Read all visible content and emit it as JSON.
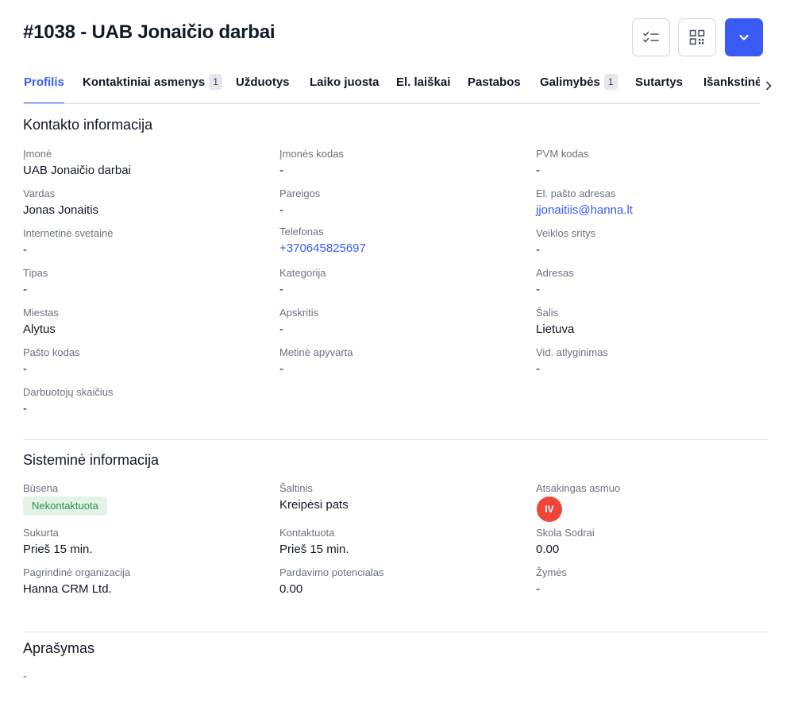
{
  "header": {
    "title": "#1038 - UAB Jonaičio darbai",
    "buttons": {
      "tasks_icon": "checklist-icon",
      "qr_icon": "qr-code-icon",
      "menu_icon": "chevron-down-icon",
      "primary_color": "#3b5bf6"
    }
  },
  "tabs": [
    {
      "label": "Profilis",
      "active": true
    },
    {
      "label": "Kontaktiniai asmenys",
      "badge": "1"
    },
    {
      "label": "Užduotys"
    },
    {
      "label": "Laiko juosta"
    },
    {
      "label": "El. laiškai"
    },
    {
      "label": "Pastabos"
    },
    {
      "label": "Galimybės",
      "badge": "1"
    },
    {
      "label": "Sutartys"
    },
    {
      "label": "Išankstinės"
    }
  ],
  "contact": {
    "title": "Kontakto informacija",
    "fields": [
      {
        "label": "Įmonė",
        "value": "UAB Jonaičio darbai"
      },
      {
        "label": "Įmonės kodas",
        "value": "-"
      },
      {
        "label": "PVM kodas",
        "value": "-"
      },
      {
        "label": "Vardas",
        "value": "Jonas Jonaitis"
      },
      {
        "label": "Pareigos",
        "value": "-"
      },
      {
        "label": "El. pašto adresas",
        "value": "jjonaitiis@hanna.lt"
      },
      {
        "label": "Internetinė svetainė",
        "value": "-"
      },
      {
        "label": "Telefonas",
        "value": "+370645825697"
      },
      {
        "label": "Veiklos sritys",
        "value": "-"
      },
      {
        "label": "Tipas",
        "value": "-"
      },
      {
        "label": "Kategorija",
        "value": "-"
      },
      {
        "label": "Adresas",
        "value": "-"
      },
      {
        "label": "Miestas",
        "value": "Alytus"
      },
      {
        "label": "Apskritis",
        "value": "-"
      },
      {
        "label": "Šalis",
        "value": "Lietuva"
      },
      {
        "label": "Pašto kodas",
        "value": "-"
      },
      {
        "label": "Metinė apyvarta",
        "value": "-"
      },
      {
        "label": "Vid. atlyginimas",
        "value": "-"
      },
      {
        "label": "Darbuotojų skaičius",
        "value": "-"
      }
    ]
  },
  "system": {
    "title": "Sisteminė informacija",
    "status_label": "Būsena",
    "status_value": "Nekontaktuota",
    "source_label": "Šaltinis",
    "source_value": "Kreipėsi pats",
    "owner_label": "Atsakingas asmuo",
    "owner_initials": "IV",
    "fields": [
      {
        "label": "Sukurta",
        "value": "Prieš 15 min."
      },
      {
        "label": "Kontaktuota",
        "value": "Prieš 15 min."
      },
      {
        "label": "Skola Sodrai",
        "value": "0.00"
      },
      {
        "label": "Pagrindinė organizacija",
        "value": "Hanna CRM Ltd."
      },
      {
        "label": "Pardavimo potencialas",
        "value": "0.00"
      },
      {
        "label": "Žymės",
        "value": "-"
      }
    ]
  },
  "description": {
    "title": "Aprašymas",
    "value": "-"
  }
}
